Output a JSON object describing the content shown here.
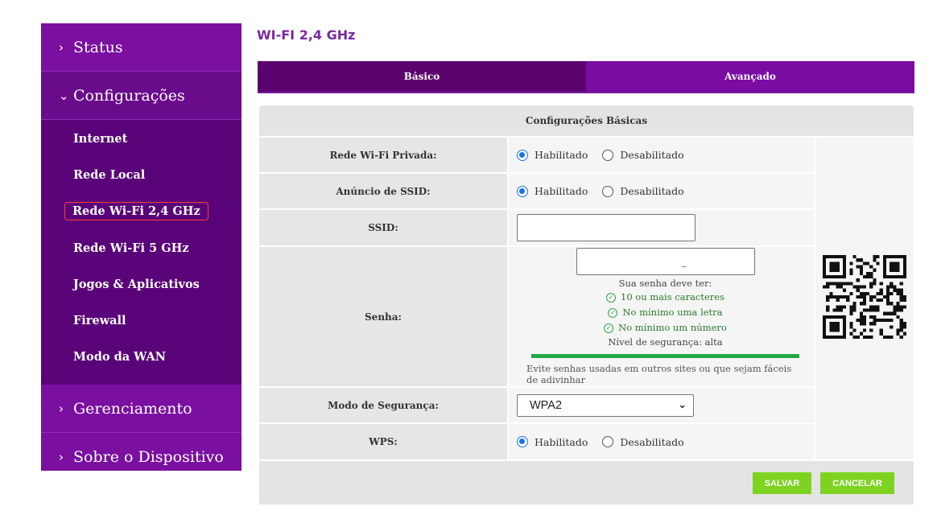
{
  "sidebar": {
    "status": "Status",
    "configuracoes": "Configurações",
    "items": [
      "Internet",
      "Rede Local",
      "Rede Wi-Fi 2,4 GHz",
      "Rede Wi-Fi 5 GHz",
      "Jogos & Aplicativos",
      "Firewall",
      "Modo da WAN"
    ],
    "active_item": "Rede Wi-Fi 2,4 GHz",
    "gerenciamento": "Gerenciamento",
    "sobre": "Sobre o Dispositivo"
  },
  "page_title": "WI-FI 2,4 GHz",
  "tabs": {
    "basic": "Básico",
    "advanced": "Avançado"
  },
  "panel_title": "Configurações Básicas",
  "form": {
    "private_wifi": {
      "label": "Rede Wi-Fi Privada:",
      "enabled": "Habilitado",
      "disabled": "Desabilitado",
      "selected": "Habilitado"
    },
    "ssid_announce": {
      "label": "Anúncio de SSID:",
      "enabled": "Habilitado",
      "disabled": "Desabilitado",
      "selected": "Habilitado"
    },
    "ssid": {
      "label": "SSID:",
      "value": ""
    },
    "password": {
      "label": "Senha:",
      "value": "",
      "hint_title": "Sua senha deve ter:",
      "req1": "10 ou mais caracteres",
      "req2": "No mínimo uma letra",
      "req3": "No mínimo um número",
      "strength": "Nível de segurança: alta",
      "note": "Evite senhas usadas em outros sites ou que sejam fáceis de adivinhar"
    },
    "security_mode": {
      "label": "Modo de Segurança:",
      "value": "WPA2"
    },
    "wps": {
      "label": "WPS:",
      "enabled": "Habilitado",
      "disabled": "Desabilitado",
      "selected": "Habilitado"
    }
  },
  "buttons": {
    "save": "SALVAR",
    "cancel": "CANCELAR"
  },
  "colors": {
    "sidebar": "#7a0fa0",
    "sidebar_sub": "#5a0479",
    "accent_green": "#7ed321",
    "radio": "#1a73e8"
  }
}
